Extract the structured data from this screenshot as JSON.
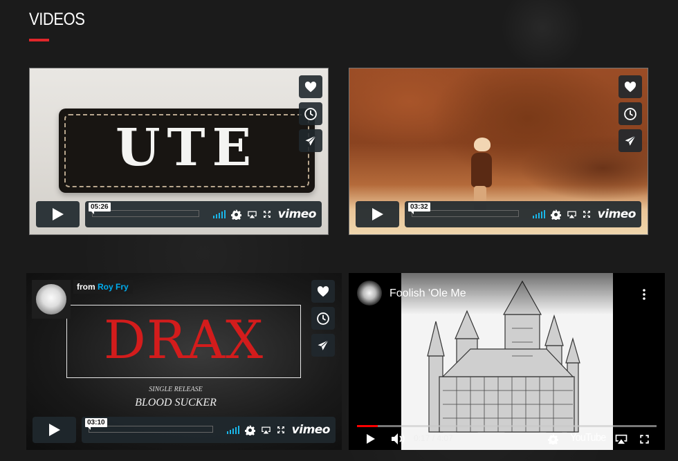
{
  "section": {
    "title": "VIDEOS",
    "accent_color": "#e0262a"
  },
  "videos": [
    {
      "provider": "vimeo",
      "thumbnail_text": "UTE",
      "time": "05:26",
      "logo": "vimeo"
    },
    {
      "provider": "vimeo",
      "time": "03:32",
      "logo": "vimeo"
    },
    {
      "provider": "vimeo",
      "from_label": "from",
      "author": "Roy Fry",
      "title_art": "DRAX",
      "subtitle_small": "SINGLE RELEASE",
      "subtitle_large": "BLOOD SUCKER",
      "time": "03:10",
      "logo": "vimeo"
    },
    {
      "provider": "youtube",
      "title": "Foolish 'Ole Me",
      "time": "0:17 / 4:07",
      "progress_fraction": 0.069,
      "logo": "YouTube"
    }
  ],
  "icons": {
    "like": "heart-icon",
    "watch_later": "clock-icon",
    "share": "paper-plane-icon",
    "play": "play-icon",
    "volume": "volume-icon",
    "settings": "gear-icon",
    "airplay": "airplay-icon",
    "fullscreen": "fullscreen-icon",
    "more": "more-vertical-icon"
  },
  "colors": {
    "vimeo_blue": "#1ab7ea",
    "youtube_red": "#ff0000"
  }
}
